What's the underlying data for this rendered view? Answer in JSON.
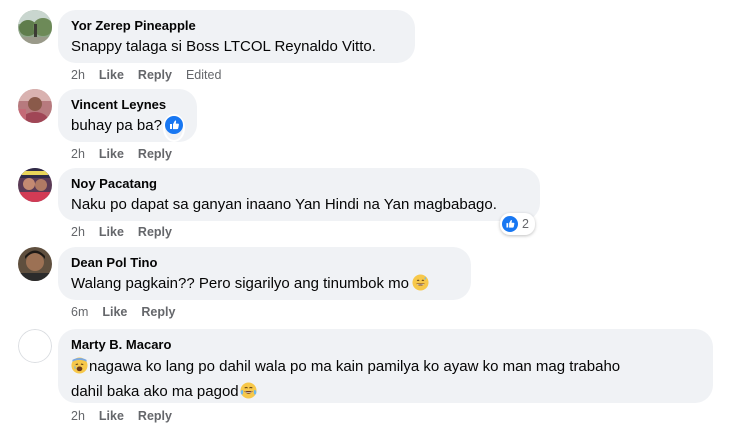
{
  "comments": [
    {
      "author": "Yor Zerep Pineapple",
      "text": "Snappy talaga si Boss LTCOL Reynaldo Vitto.",
      "time": "2h",
      "like_label": "Like",
      "reply_label": "Reply",
      "edited_label": "Edited"
    },
    {
      "author": "Vincent Leynes",
      "text": "buhay pa ba?",
      "time": "2h",
      "like_label": "Like",
      "reply_label": "Reply",
      "reaction": "like-icon"
    },
    {
      "author": "Noy Pacatang",
      "text": "Naku po dapat sa ganyan inaano Yan Hindi na Yan magbabago.",
      "time": "2h",
      "like_label": "Like",
      "reply_label": "Reply",
      "reaction_count": "2",
      "reaction": "like-icon"
    },
    {
      "author": "Dean Pol Tino",
      "text": "Walang pagkain?? Pero sigarilyo ang tinumbok mo",
      "time": "6m",
      "like_label": "Like",
      "reply_label": "Reply",
      "emoji": "grinning-sweat-emoji"
    },
    {
      "author": "Marty B. Macaro",
      "text_line1": "nagawa ko lang po dahil wala po ma kain pamilya ko ayaw ko man mag trabaho",
      "text_line2": "dahil baka ako ma pagod",
      "time": "2h",
      "like_label": "Like",
      "reply_label": "Reply",
      "emoji_start": "crying-sweat-emoji",
      "emoji_end": "tears-of-joy-emoji"
    }
  ],
  "colors": {
    "bubble": "#f0f2f5",
    "meta": "#65676b",
    "like_blue": "#1877f2"
  }
}
